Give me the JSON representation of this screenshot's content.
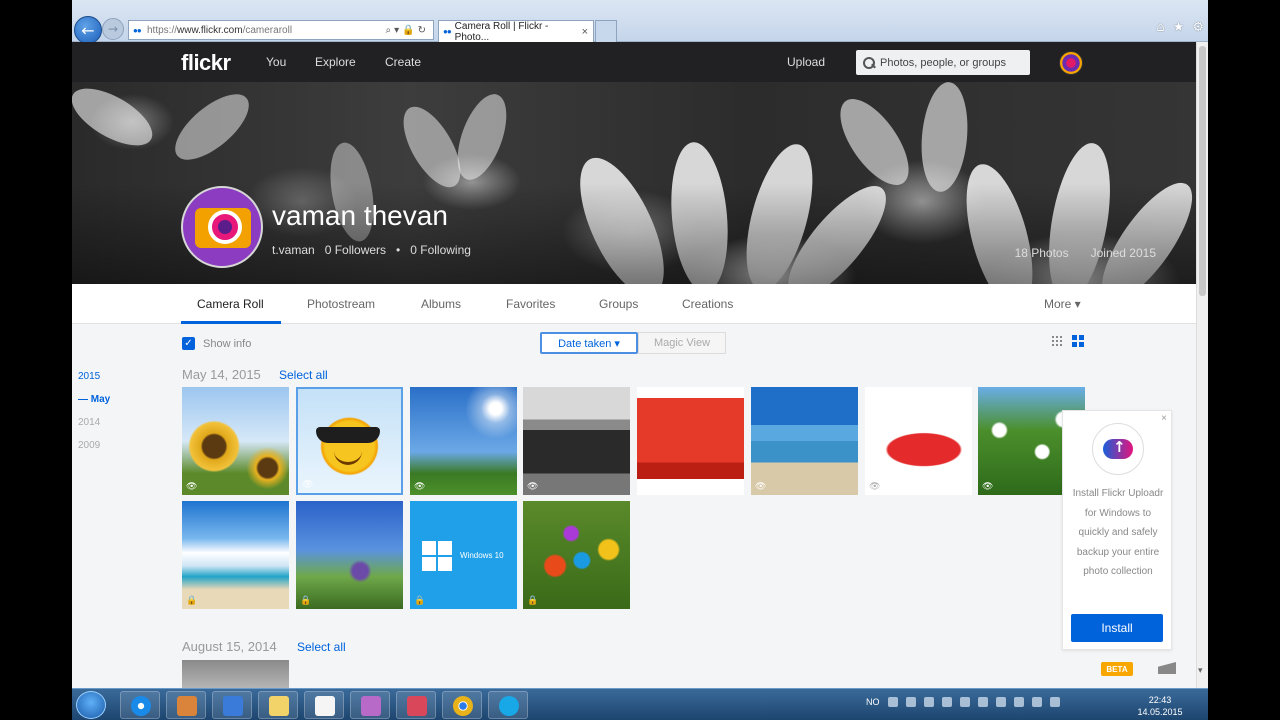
{
  "browser": {
    "address_prefix": "https://",
    "address_host": "www.flickr.com",
    "address_path": "/cameraroll",
    "tab_title": "Camera Roll | Flickr - Photo...",
    "tab_close": "×"
  },
  "nav": {
    "logo": "flickr",
    "you": "You",
    "explore": "Explore",
    "create": "Create",
    "upload": "Upload",
    "search_placeholder": "Photos, people, or groups"
  },
  "profile": {
    "name": "vaman thevan",
    "username": "t.vaman",
    "followers": "0 Followers",
    "separator": "•",
    "following": "0 Following",
    "photos": "18 Photos",
    "joined": "Joined 2015"
  },
  "tabs": {
    "camera_roll": "Camera Roll",
    "photostream": "Photostream",
    "albums": "Albums",
    "favorites": "Favorites",
    "groups": "Groups",
    "creations": "Creations",
    "more": "More ▾"
  },
  "toolbar": {
    "show_info": "Show info",
    "date_taken": "Date taken ▾",
    "magic_view": "Magic View"
  },
  "timeline": {
    "y2015": "2015",
    "may": "— May",
    "y2014": "2014",
    "y2009": "2009"
  },
  "sections": [
    {
      "date": "May 14, 2015",
      "select_all": "Select all"
    },
    {
      "date": "August 15, 2014",
      "select_all": "Select all"
    }
  ],
  "photo_badges": {
    "public": "👁",
    "private": "🔒"
  },
  "photo_text": {
    "windows": "Windows 10"
  },
  "install": {
    "close": "×",
    "text": "Install Flickr Uploadr for Windows to quickly and safely backup your entire photo collection",
    "button": "Install"
  },
  "beta": "BETA",
  "taskbar": {
    "lang": "NO",
    "time": "22:43",
    "date": "14.05.2015"
  },
  "colors": {
    "accent": "#0063dc",
    "nav_bg": "#212124"
  }
}
